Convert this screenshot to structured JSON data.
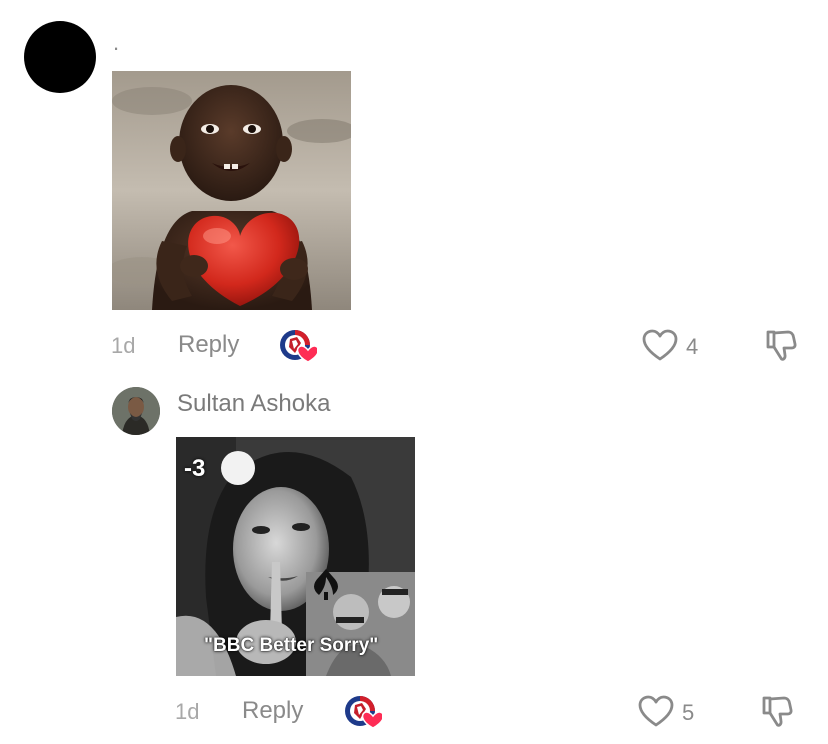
{
  "comments": [
    {
      "username": ".",
      "time": "1d",
      "reply_label": "Reply",
      "like_count": "4",
      "image": {
        "type": "photo-child-holding-red-heart"
      }
    },
    {
      "username": "Sultan Ashoka",
      "time": "1d",
      "reply_label": "Reply",
      "like_count": "5",
      "image": {
        "type": "meme-woman-shush",
        "overlay_number": "-3",
        "caption": "\"BBC Better Sorry\""
      }
    }
  ],
  "icons": {
    "like": "heart-outline-icon",
    "dislike": "thumbs-down-icon",
    "creator_reaction": "creator-liked-badge-icon"
  },
  "colors": {
    "text_muted": "#8a8a8a",
    "time_muted": "#a8a8a8",
    "heart_red": "#fe2c55"
  }
}
